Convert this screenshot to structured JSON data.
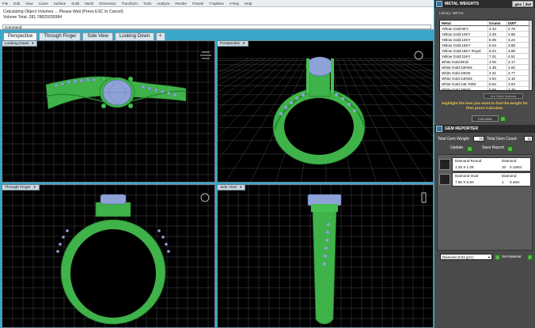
{
  "menubar": {
    "items": [
      "File",
      "Edit",
      "View",
      "Curve",
      "Surface",
      "Solid",
      "Mesh",
      "Dimension",
      "Transform",
      "Tools",
      "Analyze",
      "Render",
      "Panels",
      "T-Splines",
      "V-Ray",
      "Help"
    ]
  },
  "command": {
    "line1": "Calculating Object Volumes ... Please Wait (Press ESC to Cancel)",
    "line2": "Volume Total: 281.78825035984",
    "prompt": "Command:"
  },
  "tabs": [
    {
      "label": "Perspective",
      "active": true
    },
    {
      "label": "Through Finger",
      "active": false
    },
    {
      "label": "Side View",
      "active": false
    },
    {
      "label": "Looking Down",
      "active": false
    },
    {
      "label": "+",
      "active": false
    }
  ],
  "viewports": [
    {
      "label": "Looking Down"
    },
    {
      "label": "Perspective"
    },
    {
      "label": "Through Finger"
    },
    {
      "label": "Side View"
    }
  ],
  "colors": {
    "metal": "#3fb24a",
    "gem": "#8ea2d8",
    "grid": "#4a4a4a",
    "accent": "#3aa7c9",
    "hint": "#f3c64b"
  },
  "metal_panel": {
    "title": "METAL WEIGHTS",
    "tag1": "gms",
    "tag2": "dwt",
    "library_label": "Library: METAL",
    "columns": [
      "Metal",
      "Grams",
      "DWT"
    ],
    "rows": [
      {
        "metal": "Yellow Gold:9KY",
        "grams": "4.34",
        "dwt": "2.79"
      },
      {
        "metal": "Yellow Gold:10KY",
        "grams": "4.49",
        "dwt": "2.88"
      },
      {
        "metal": "Yellow Gold:14KY",
        "grams": "5.05",
        "dwt": "3.24"
      },
      {
        "metal": "Yellow Gold:18KY",
        "grams": "6.04",
        "dwt": "3.88"
      },
      {
        "metal": "Yellow Gold:18KY Royal",
        "grams": "6.04",
        "dwt": "3.88"
      },
      {
        "metal": "Yellow Gold:22KY",
        "grams": "7.01",
        "dwt": "4.51"
      },
      {
        "metal": "White Gold:9KW",
        "grams": "4.93",
        "dwt": "3.17"
      },
      {
        "metal": "White Gold:10KW1",
        "grams": "4.38",
        "dwt": "2.82"
      },
      {
        "metal": "White Gold:10KW",
        "grams": "4.31",
        "dwt": "2.77"
      },
      {
        "metal": "White Gold:14KW1",
        "grams": "4.94",
        "dwt": "3.18"
      },
      {
        "metal": "White Gold:14K PdW",
        "grams": "5.64",
        "dwt": "3.63"
      },
      {
        "metal": "White Gold:18KW",
        "grams": "5.88",
        "dwt": "3.78"
      }
    ],
    "small_button": "Use Object Materials",
    "hint": "Highlight the item you want to find the weight for then press Calculate.",
    "calculate": "Calculate"
  },
  "gem_panel": {
    "title": "GEM REPORTER",
    "total_weight_label": "Total Gem Weight:",
    "total_weight_value": "76",
    "total_count_label": "Total Gem Count:",
    "total_count_value": "11",
    "update_label": "Update",
    "save_label": "Save Report",
    "items": [
      {
        "name": "Diamond Round",
        "size": "1.25 X 1.25",
        "type": "Diamond",
        "count": "10",
        "weight": "0.126ct"
      },
      {
        "name": "Diamond Oval",
        "size": "7.50 X 5.50",
        "type": "Diamond",
        "count": "1",
        "weight": "0.46ct"
      }
    ],
    "select_value": "Diamond   (3.52 g/cc)",
    "set_material": "Set Material"
  }
}
